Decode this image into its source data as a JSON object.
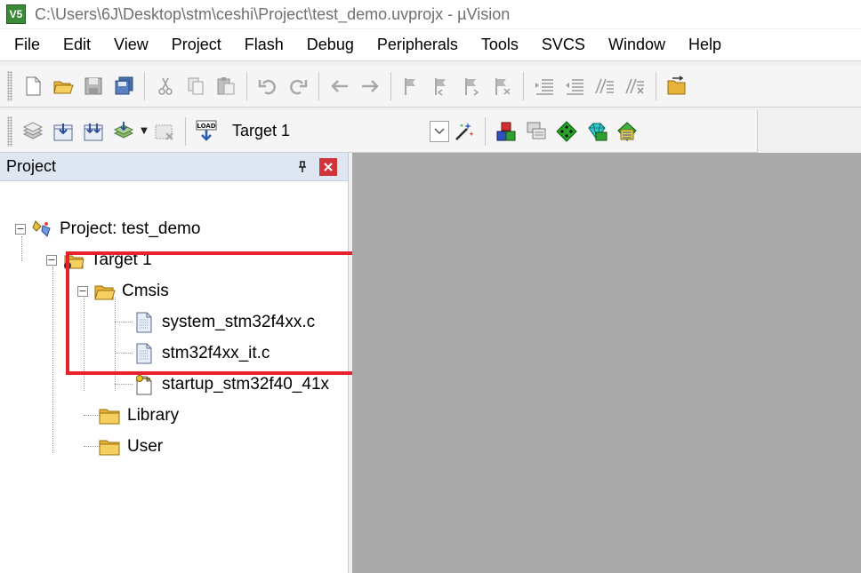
{
  "window": {
    "title": "C:\\Users\\6J\\Desktop\\stm\\ceshi\\Project\\test_demo.uvprojx - µVision",
    "app_icon_text": "V5"
  },
  "menu": {
    "items": [
      "File",
      "Edit",
      "View",
      "Project",
      "Flash",
      "Debug",
      "Peripherals",
      "Tools",
      "SVCS",
      "Window",
      "Help"
    ]
  },
  "toolbar2": {
    "load_label": "LOAD",
    "target": "Target 1"
  },
  "project_panel": {
    "title": "Project",
    "pin": "ᵖ",
    "close": "×",
    "tree": {
      "root": "Project: test_demo",
      "target": "Target 1",
      "groups": [
        {
          "name": "Cmsis",
          "files": [
            "system_stm32f4xx.c",
            "stm32f4xx_it.c",
            "startup_stm32f40_41x"
          ]
        },
        {
          "name": "Library"
        },
        {
          "name": "User"
        }
      ]
    }
  },
  "colors": {
    "highlight": "#e8222a",
    "editor_bg": "#a9a9a9",
    "panel_header": "#dde6f1"
  }
}
